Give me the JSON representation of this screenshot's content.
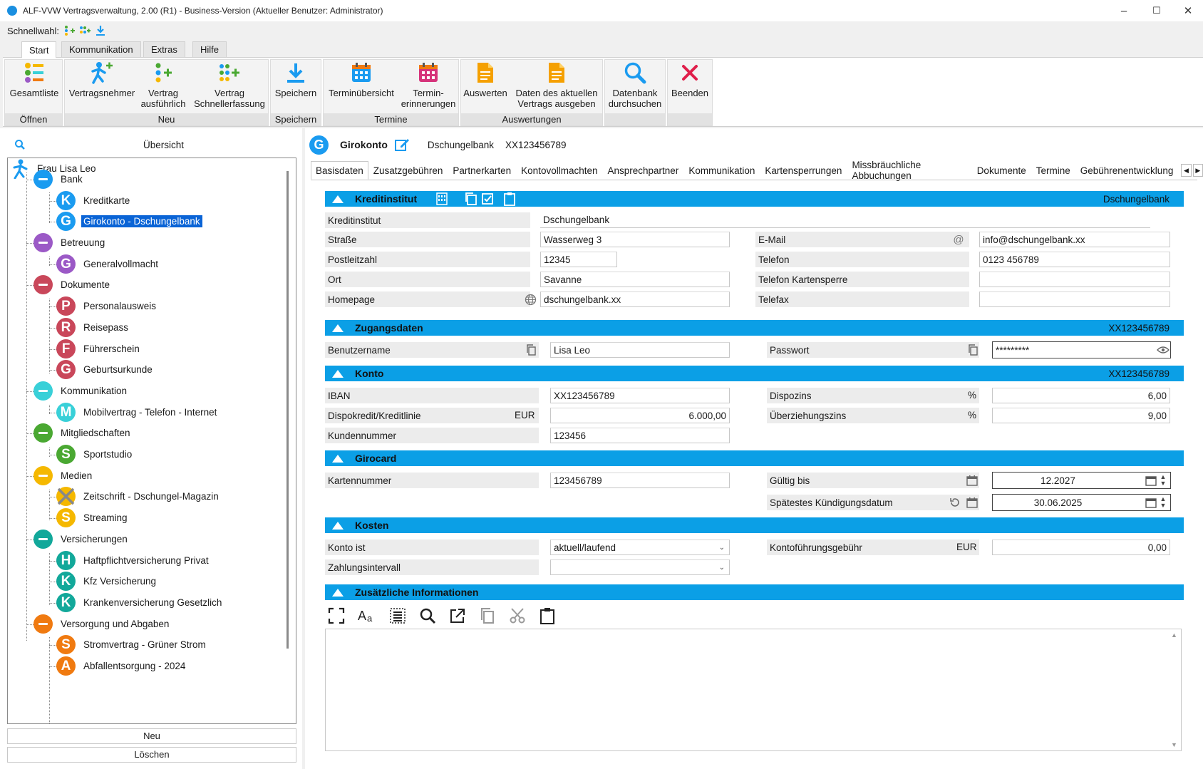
{
  "window": {
    "title": "ALF-VVW Vertragsverwaltung, 2.00 (R1) - Business-Version (Aktueller Benutzer: Administrator)",
    "minimize": "–",
    "maximize": "☐",
    "close": "✕"
  },
  "quickbar": {
    "label": "Schnellwahl:"
  },
  "ribbon_tabs": [
    "Start",
    "Kommunikation",
    "Extras",
    "Hilfe"
  ],
  "ribbon": {
    "buttons": {
      "gesamtliste": "Gesamtliste",
      "vertragsnehmer": "Vertragsnehmer",
      "vertrag_ausf_1": "Vertrag",
      "vertrag_ausf_2": "ausführlich",
      "vertrag_schnell_1": "Vertrag",
      "vertrag_schnell_2": "Schnellerfassung",
      "speichern": "Speichern",
      "termin_ueb": "Terminübersicht",
      "termin_er_1": "Termin-",
      "termin_er_2": "erinnerungen",
      "auswerten": "Auswerten",
      "daten_1": "Daten des aktuellen",
      "daten_2": "Vertrags ausgeben",
      "db_1": "Datenbank",
      "db_2": "durchsuchen",
      "beenden": "Beenden"
    },
    "groups": {
      "oeffnen": "Öffnen",
      "neu": "Neu",
      "speichern": "Speichern",
      "termine": "Termine",
      "auswertungen": "Auswertungen"
    }
  },
  "left": {
    "overview_title": "Übersicht",
    "root": "Frau Lisa Leo",
    "categories": [
      {
        "label": "Bank",
        "color": "#1a9bf0"
      },
      {
        "label": "Betreuung",
        "color": "#9b59c6"
      },
      {
        "label": "Dokumente",
        "color": "#c9475a"
      },
      {
        "label": "Kommunikation",
        "color": "#39d0d8"
      },
      {
        "label": "Mitgliedschaften",
        "color": "#4aa832"
      },
      {
        "label": "Medien",
        "color": "#f5b800"
      },
      {
        "label": "Versicherungen",
        "color": "#12a89a"
      },
      {
        "label": "Versorgung und Abgaben",
        "color": "#f07a10"
      }
    ],
    "items": [
      {
        "letter": "K",
        "label": "Kreditkarte"
      },
      {
        "letter": "G",
        "label": "Girokonto - Dschungelbank"
      },
      {
        "letter": "G",
        "label": "Generalvollmacht"
      },
      {
        "letter": "P",
        "label": "Personalausweis"
      },
      {
        "letter": "R",
        "label": "Reisepass"
      },
      {
        "letter": "F",
        "label": "Führerschein"
      },
      {
        "letter": "G",
        "label": "Geburtsurkunde"
      },
      {
        "letter": "M",
        "label": "Mobilvertrag - Telefon - Internet"
      },
      {
        "letter": "S",
        "label": "Sportstudio"
      },
      {
        "letter": "",
        "label": "Zeitschrift - Dschungel-Magazin"
      },
      {
        "letter": "S",
        "label": "Streaming"
      },
      {
        "letter": "H",
        "label": "Haftpflichtversicherung Privat"
      },
      {
        "letter": "K",
        "label": "Kfz Versicherung"
      },
      {
        "letter": "K",
        "label": "Krankenversicherung Gesetzlich"
      },
      {
        "letter": "S",
        "label": "Stromvertrag - Grüner Strom"
      },
      {
        "letter": "A",
        "label": "Abfallentsorgung - 2024"
      }
    ],
    "btn_neu": "Neu",
    "btn_loeschen": "Löschen"
  },
  "contract": {
    "icon_letter": "G",
    "type": "Girokonto",
    "bank": "Dschungelbank",
    "number": "XX123456789"
  },
  "tabs": [
    "Basisdaten",
    "Zusatzgebühren",
    "Partnerkarten",
    "Kontovollmachten",
    "Ansprechpartner",
    "Kommunikation",
    "Kartensperrungen",
    "Missbräuchliche Abbuchungen",
    "Dokumente",
    "Termine",
    "Gebührenentwicklung"
  ],
  "sections": {
    "kreditinstitut": {
      "title": "Kreditinstitut",
      "right": "Dschungelbank"
    },
    "zugang": {
      "title": "Zugangsdaten",
      "right": "XX123456789"
    },
    "konto": {
      "title": "Konto",
      "right": "XX123456789"
    },
    "girocard": {
      "title": "Girocard",
      "right": ""
    },
    "kosten": {
      "title": "Kosten",
      "right": ""
    },
    "zusatz": {
      "title": "Zusätzliche Informationen",
      "right": ""
    }
  },
  "fields": {
    "kreditinstitut": {
      "label": "Kreditinstitut",
      "value": "Dschungelbank"
    },
    "strasse": {
      "label": "Straße",
      "value": "Wasserweg 3"
    },
    "plz": {
      "label": "Postleitzahl",
      "value": "12345"
    },
    "ort": {
      "label": "Ort",
      "value": "Savanne"
    },
    "homepage": {
      "label": "Homepage",
      "value": "dschungelbank.xx"
    },
    "email": {
      "label": "E-Mail",
      "value": "info@dschungelbank.xx"
    },
    "telefon": {
      "label": "Telefon",
      "value": "0123 456789"
    },
    "tel_sperre": {
      "label": "Telefon Kartensperre",
      "value": ""
    },
    "telefax": {
      "label": "Telefax",
      "value": ""
    },
    "benutzername": {
      "label": "Benutzername",
      "value": "Lisa Leo"
    },
    "passwort": {
      "label": "Passwort",
      "value": "*********"
    },
    "iban": {
      "label": "IBAN",
      "value": "XX123456789"
    },
    "dispo": {
      "label": "Dispokredit/Kreditlinie",
      "unit": "EUR",
      "value": "6.000,00"
    },
    "kundennr": {
      "label": "Kundennummer",
      "value": "123456"
    },
    "dispozins": {
      "label": "Dispozins",
      "unit": "%",
      "value": "6,00"
    },
    "ueberzins": {
      "label": "Überziehungszins",
      "unit": "%",
      "value": "9,00"
    },
    "kartennr": {
      "label": "Kartennummer",
      "value": "123456789"
    },
    "gueltig": {
      "label": "Gültig bis",
      "value": "12.2027"
    },
    "kuendigung": {
      "label": "Spätestes Kündigungsdatum",
      "value": "30.06.2025"
    },
    "konto_ist": {
      "label": "Konto ist",
      "value": "aktuell/laufend"
    },
    "zahlint": {
      "label": "Zahlungsintervall",
      "value": ""
    },
    "kontogeb": {
      "label": "Kontoführungsgebühr",
      "unit": "EUR",
      "value": "0,00"
    }
  }
}
